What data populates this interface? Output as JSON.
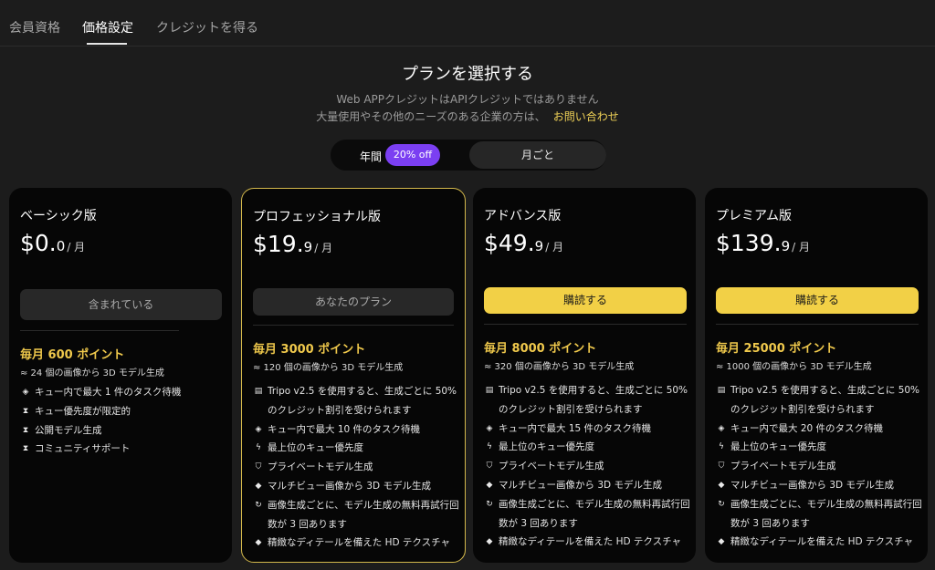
{
  "tabs": [
    "会員資格",
    "価格設定",
    "クレジットを得る"
  ],
  "header": {
    "title": "プランを選択する",
    "subtitle1": "Web APPクレジットはAPIクレジットではありません",
    "subtitle2": "大量使用やその他のニーズのある企業の方は、",
    "contact_link": "お問い合わせ"
  },
  "billing_toggle": {
    "annual": "年間",
    "discount_badge": "20% off",
    "monthly": "月ごと",
    "selected": "月ごと"
  },
  "colors": {
    "accent_yellow": "#f2d046",
    "points_gold": "#f0c94c",
    "badge_purple": "#7b3ff2",
    "highlight_border": "#d4b94c"
  },
  "plans": [
    {
      "name": "ベーシック版",
      "price_main": "$0.",
      "price_decimal": "0",
      "price_period": "/ 月",
      "button": "含まれている",
      "points": "毎月 600 ポイント",
      "approx": "≈ 24 個の画像から 3D モデル生成",
      "features": [
        {
          "icon": "layers-icon",
          "text": "キュー内で最大 1 件のタスク待機"
        },
        {
          "icon": "hourglass-icon",
          "text": "キュー優先度が限定的"
        },
        {
          "icon": "hourglass-icon",
          "text": "公開モデル生成"
        },
        {
          "icon": "hourglass-icon",
          "text": "コミュニティサポート"
        }
      ]
    },
    {
      "name": "プロフェッショナル版",
      "price_main": "$19.",
      "price_decimal": "9",
      "price_period": "/ 月",
      "button": "あなたのプラン",
      "points": "毎月 3000 ポイント",
      "approx": "≈ 120 個の画像から 3D モデル生成",
      "features": [
        {
          "icon": "coins-icon",
          "text": "Tripo v2.5 を使用すると、生成ごとに 50% のクレジット割引を受けられます"
        },
        {
          "icon": "layers-icon",
          "text": "キュー内で最大 10 件のタスク待機"
        },
        {
          "icon": "lightning-icon",
          "text": "最上位のキュー優先度"
        },
        {
          "icon": "shield-icon",
          "text": "プライベートモデル生成"
        },
        {
          "icon": "cube-icon",
          "text": "マルチビュー画像から 3D モデル生成"
        },
        {
          "icon": "retry-icon",
          "text": "画像生成ごとに、モデル生成の無料再試行回数が 3 回あります"
        },
        {
          "icon": "cube-icon",
          "text": "精緻なディテールを備えた HD テクスチャ"
        }
      ]
    },
    {
      "name": "アドバンス版",
      "price_main": "$49.",
      "price_decimal": "9",
      "price_period": "/ 月",
      "button": "購読する",
      "points": "毎月 8000 ポイント",
      "approx": "≈ 320 個の画像から 3D モデル生成",
      "features": [
        {
          "icon": "coins-icon",
          "text": "Tripo v2.5 を使用すると、生成ごとに 50% のクレジット割引を受けられます"
        },
        {
          "icon": "layers-icon",
          "text": "キュー内で最大 15 件のタスク待機"
        },
        {
          "icon": "lightning-icon",
          "text": "最上位のキュー優先度"
        },
        {
          "icon": "shield-icon",
          "text": "プライベートモデル生成"
        },
        {
          "icon": "cube-icon",
          "text": "マルチビュー画像から 3D モデル生成"
        },
        {
          "icon": "retry-icon",
          "text": "画像生成ごとに、モデル生成の無料再試行回数が 3 回あります"
        },
        {
          "icon": "cube-icon",
          "text": "精緻なディテールを備えた HD テクスチャ"
        }
      ]
    },
    {
      "name": "プレミアム版",
      "price_main": "$139.",
      "price_decimal": "9",
      "price_period": "/ 月",
      "button": "購読する",
      "points": "毎月 25000 ポイント",
      "approx": "≈ 1000 個の画像から 3D モデル生成",
      "features": [
        {
          "icon": "coins-icon",
          "text": "Tripo v2.5 を使用すると、生成ごとに 50% のクレジット割引を受けられます"
        },
        {
          "icon": "layers-icon",
          "text": "キュー内で最大 20 件のタスク待機"
        },
        {
          "icon": "lightning-icon",
          "text": "最上位のキュー優先度"
        },
        {
          "icon": "shield-icon",
          "text": "プライベートモデル生成"
        },
        {
          "icon": "cube-icon",
          "text": "マルチビュー画像から 3D モデル生成"
        },
        {
          "icon": "retry-icon",
          "text": "画像生成ごとに、モデル生成の無料再試行回数が 3 回あります"
        },
        {
          "icon": "cube-icon",
          "text": "精緻なディテールを備えた HD テクスチャ"
        }
      ]
    }
  ]
}
